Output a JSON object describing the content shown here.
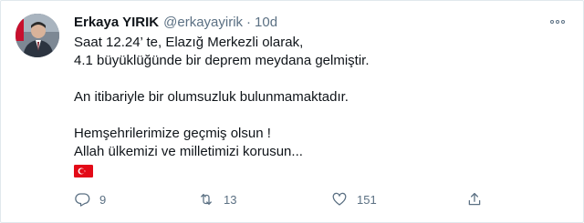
{
  "author": {
    "display_name": "Erkaya YIRIK",
    "handle": "@erkayayirik",
    "separator": "·",
    "time": "10d"
  },
  "icons": {
    "avatar": "profile-photo",
    "more": "more-options-icon",
    "flag": "turkey-flag",
    "reply": "reply-icon",
    "retweet": "retweet-icon",
    "like": "heart-icon",
    "share": "share-icon"
  },
  "tweet": {
    "lines": [
      "Saat 12.24’ te, Elazığ Merkezli olarak,",
      "4.1 büyüklüğünde bir deprem meydana gelmiştir.",
      "",
      "An itibariyle bir olumsuzluk bulunmamaktadır.",
      "",
      "Hemşehrilerimize geçmiş olsun !",
      "Allah ülkemizi ve milletimizi korusun..."
    ]
  },
  "stats": {
    "replies": "9",
    "retweets": "13",
    "likes": "151"
  },
  "colors": {
    "text": "#0f1419",
    "secondary": "#5b7083",
    "flag_red": "#e30a17",
    "border": "#e1e8ed"
  }
}
